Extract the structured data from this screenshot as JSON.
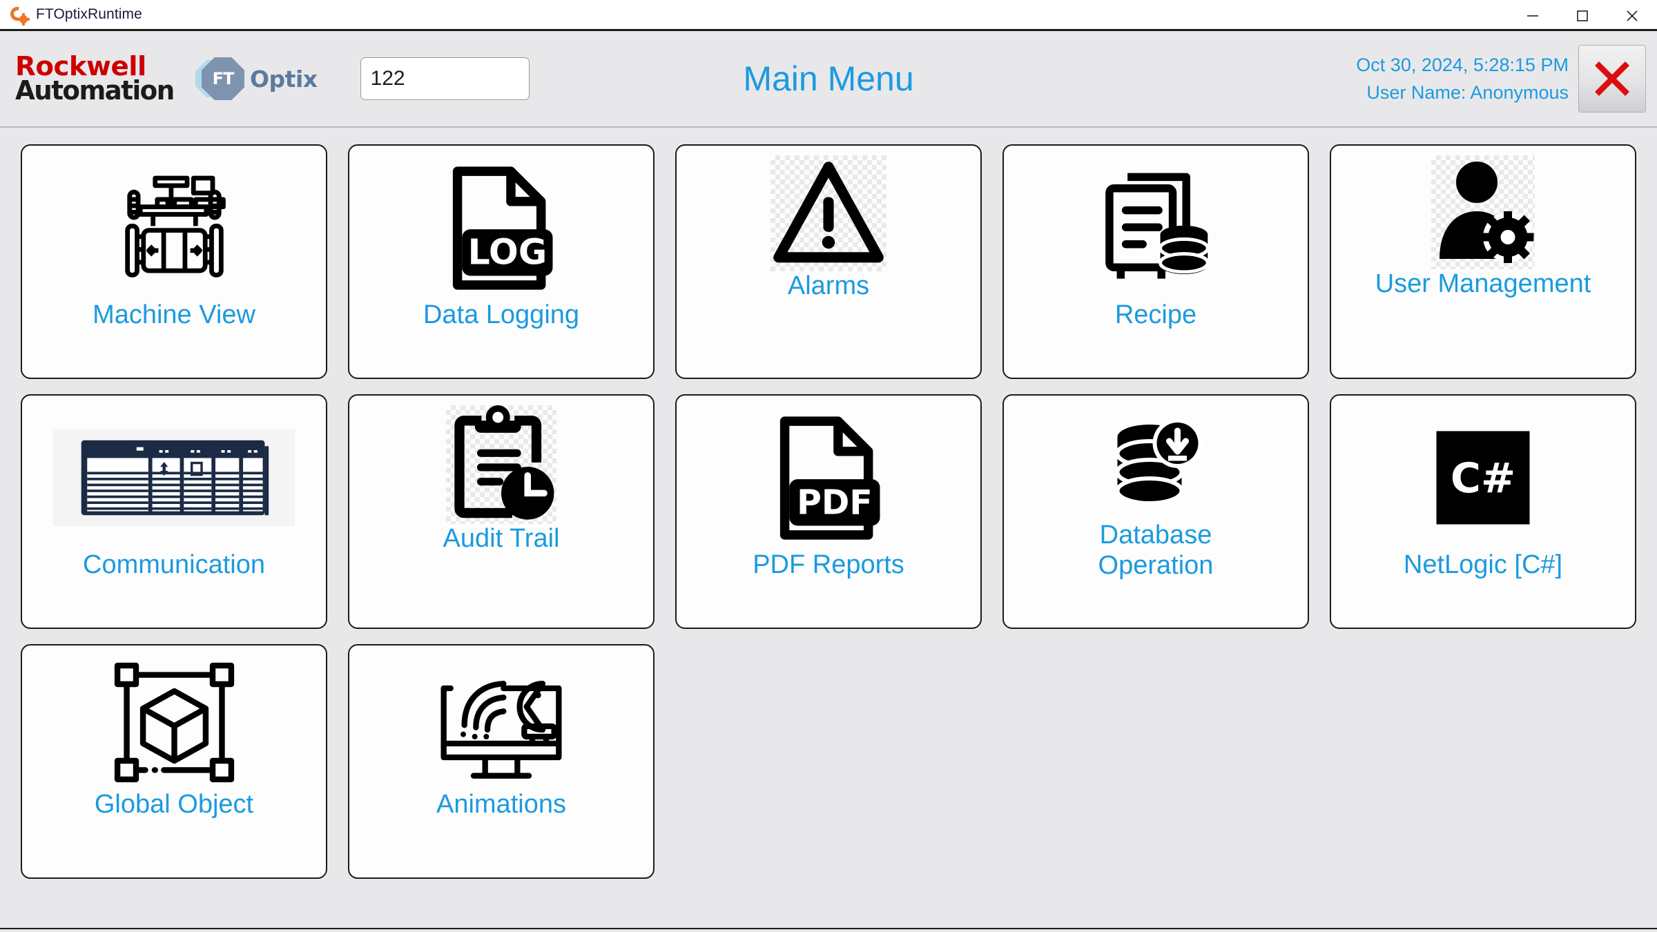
{
  "window": {
    "title": "FTOptixRuntime",
    "app_icon": "ftoptix-logo-icon",
    "controls": [
      {
        "name": "minimize-button",
        "icon": "minimize-icon"
      },
      {
        "name": "maximize-button",
        "icon": "maximize-icon"
      },
      {
        "name": "close-button",
        "icon": "close-icon"
      }
    ]
  },
  "header": {
    "brand_line1": "Rockwell",
    "brand_line2": "Automation",
    "product_badge": "FT",
    "product_name": "Optix",
    "number_field": {
      "value": "122",
      "placeholder": ""
    },
    "title": "Main Menu",
    "datetime": "Oct 30, 2024, 5:28:15 PM",
    "user": "User Name: Anonymous",
    "exit_button": "exit-x-button"
  },
  "colors": {
    "accent_blue": "#1b9ae0",
    "brand_red": "#cc0000",
    "brand_black": "#1b1b1b",
    "exit_red": "#dd0d0d",
    "plc_navy": "#1b2b45",
    "page_bg": "#e8e8ea",
    "tile_bg": "#fdfdfd"
  },
  "tiles": [
    {
      "label": "Machine View",
      "icon": "machine-press-icon",
      "lines": 1
    },
    {
      "label": "Data Logging",
      "icon": "log-file-icon",
      "lines": 1
    },
    {
      "label": "Alarms",
      "icon": "warning-triangle-icon",
      "lines": 1
    },
    {
      "label": "Recipe",
      "icon": "document-database-icon",
      "lines": 1
    },
    {
      "label": "User Management",
      "icon": "user-gear-icon",
      "lines": 1
    },
    {
      "label": "Communication",
      "icon": "plc-rack-icon",
      "lines": 1
    },
    {
      "label": "Audit Trail",
      "icon": "clipboard-clock-icon",
      "lines": 1
    },
    {
      "label": "PDF Reports",
      "icon": "pdf-file-icon",
      "lines": 1
    },
    {
      "label": "Database Operation",
      "icon": "database-download-icon",
      "lines": 2,
      "label_line1": "Database",
      "label_line2": "Operation"
    },
    {
      "label": "NetLogic [C#]",
      "icon": "csharp-icon",
      "lines": 1
    },
    {
      "label": "Global Object",
      "icon": "cube-selection-icon",
      "lines": 1
    },
    {
      "label": "Animations",
      "icon": "monitor-motion-icon",
      "lines": 1
    }
  ]
}
